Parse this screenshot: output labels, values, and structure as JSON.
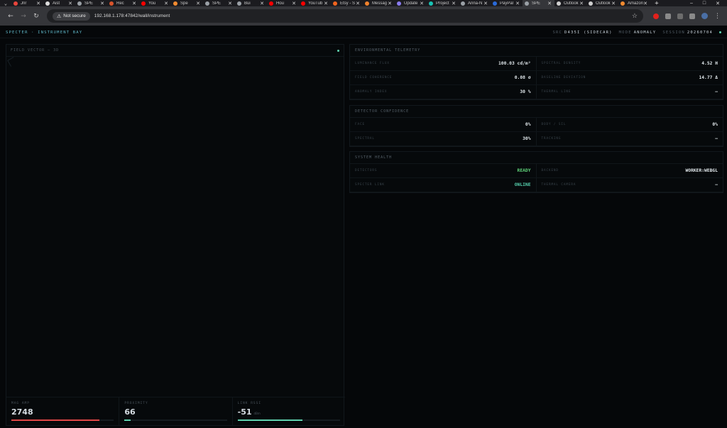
{
  "browser": {
    "tabs": [
      {
        "label": "Jnr",
        "favicon_color": "#e8453c"
      },
      {
        "label": "Aist",
        "favicon_color": "#dcdcdc"
      },
      {
        "label": "SPE",
        "favicon_color": "#9aa0a6"
      },
      {
        "label": "Rec",
        "favicon_color": "#d9542b"
      },
      {
        "label": "You",
        "favicon_color": "#ff0000"
      },
      {
        "label": "Spe",
        "favicon_color": "#f28b30"
      },
      {
        "label": "SPE",
        "favicon_color": "#9aa0a6"
      },
      {
        "label": "Bui",
        "favicon_color": "#9aa0a6"
      },
      {
        "label": "Hou",
        "favicon_color": "#ff0000"
      },
      {
        "label": "YouTub",
        "favicon_color": "#ff0000"
      },
      {
        "label": "Etsy - S",
        "favicon_color": "#f1641e"
      },
      {
        "label": "Messag",
        "favicon_color": "#f0822d"
      },
      {
        "label": "Update",
        "favicon_color": "#8a7cf0"
      },
      {
        "label": "Project",
        "favicon_color": "#19c3b5"
      },
      {
        "label": "Anna-N",
        "favicon_color": "#9aa0a6"
      },
      {
        "label": "PayPal",
        "favicon_color": "#2a6ad8"
      },
      {
        "label": "SPE",
        "favicon_color": "#9aa0a6",
        "active": true
      },
      {
        "label": "Outlook",
        "favicon_color": "#cfcfcf"
      },
      {
        "label": "Outlook",
        "favicon_color": "#cfcfcf"
      },
      {
        "label": "Amazon",
        "favicon_color": "#f28b30"
      }
    ],
    "new_tab_glyph": "+",
    "window_controls": [
      "–",
      "□",
      "✕"
    ],
    "security_label": "Not secure",
    "url": "192.168.1.178:47842/wall/instrument"
  },
  "app": {
    "brand": "SPECTER · INSTRUMENT BAY",
    "header_stats": [
      {
        "key": "SRC",
        "value": "D435I (SIDECAR)"
      },
      {
        "key": "MODE",
        "value": "ANOMALY"
      },
      {
        "key": "SESSION",
        "value": "20260704"
      }
    ],
    "status_dot_color": "#5fd3b0"
  },
  "field": {
    "title": "FIELD VECTOR — 3D",
    "metrics": [
      {
        "label": "MAG AMP",
        "value": "2748",
        "unit": "",
        "fill": 0.86,
        "color": "#e04848"
      },
      {
        "label": "PROXIMITY",
        "value": "66",
        "unit": "",
        "fill": 0.06,
        "color": "#5fd3b0"
      },
      {
        "label": "LINK RSSI",
        "value": "-51",
        "unit": "dBm",
        "fill": 0.63,
        "color": "#5fd3b0"
      }
    ]
  },
  "telemetry": {
    "title": "ENVIRONMENTAL TELEMETRY",
    "rows": [
      {
        "label": "LUMINANCE FLUX",
        "value": "100.03 cd/m²"
      },
      {
        "label": "SPECTRAL DENSITY",
        "value": "4.52 H"
      },
      {
        "label": "FIELD COHERENCE",
        "value": "0.08 σ"
      },
      {
        "label": "BASELINE DEVIATION",
        "value": "14.77 Δ"
      },
      {
        "label": "ANOMALY INDEX",
        "value": "30 %"
      },
      {
        "label": "THERMAL LINE",
        "value": "—"
      }
    ]
  },
  "confidence": {
    "title": "DETECTOR CONFIDENCE",
    "rows": [
      {
        "label": "FACE",
        "value": "0%"
      },
      {
        "label": "BODY / SIL",
        "value": "0%"
      },
      {
        "label": "SPECTRAL",
        "value": "30%"
      },
      {
        "label": "TRACKING",
        "value": "—"
      }
    ]
  },
  "health": {
    "title": "SYSTEM HEALTH",
    "rows": [
      {
        "label": "DETECTORS",
        "value": "READY",
        "status": "ok"
      },
      {
        "label": "BACKEND",
        "value": "WORKER:WEBGL"
      },
      {
        "label": "SPECTER LINK",
        "value": "ONLINE",
        "status": "ok2"
      },
      {
        "label": "THERMAL CAMERA",
        "value": "—"
      }
    ]
  }
}
